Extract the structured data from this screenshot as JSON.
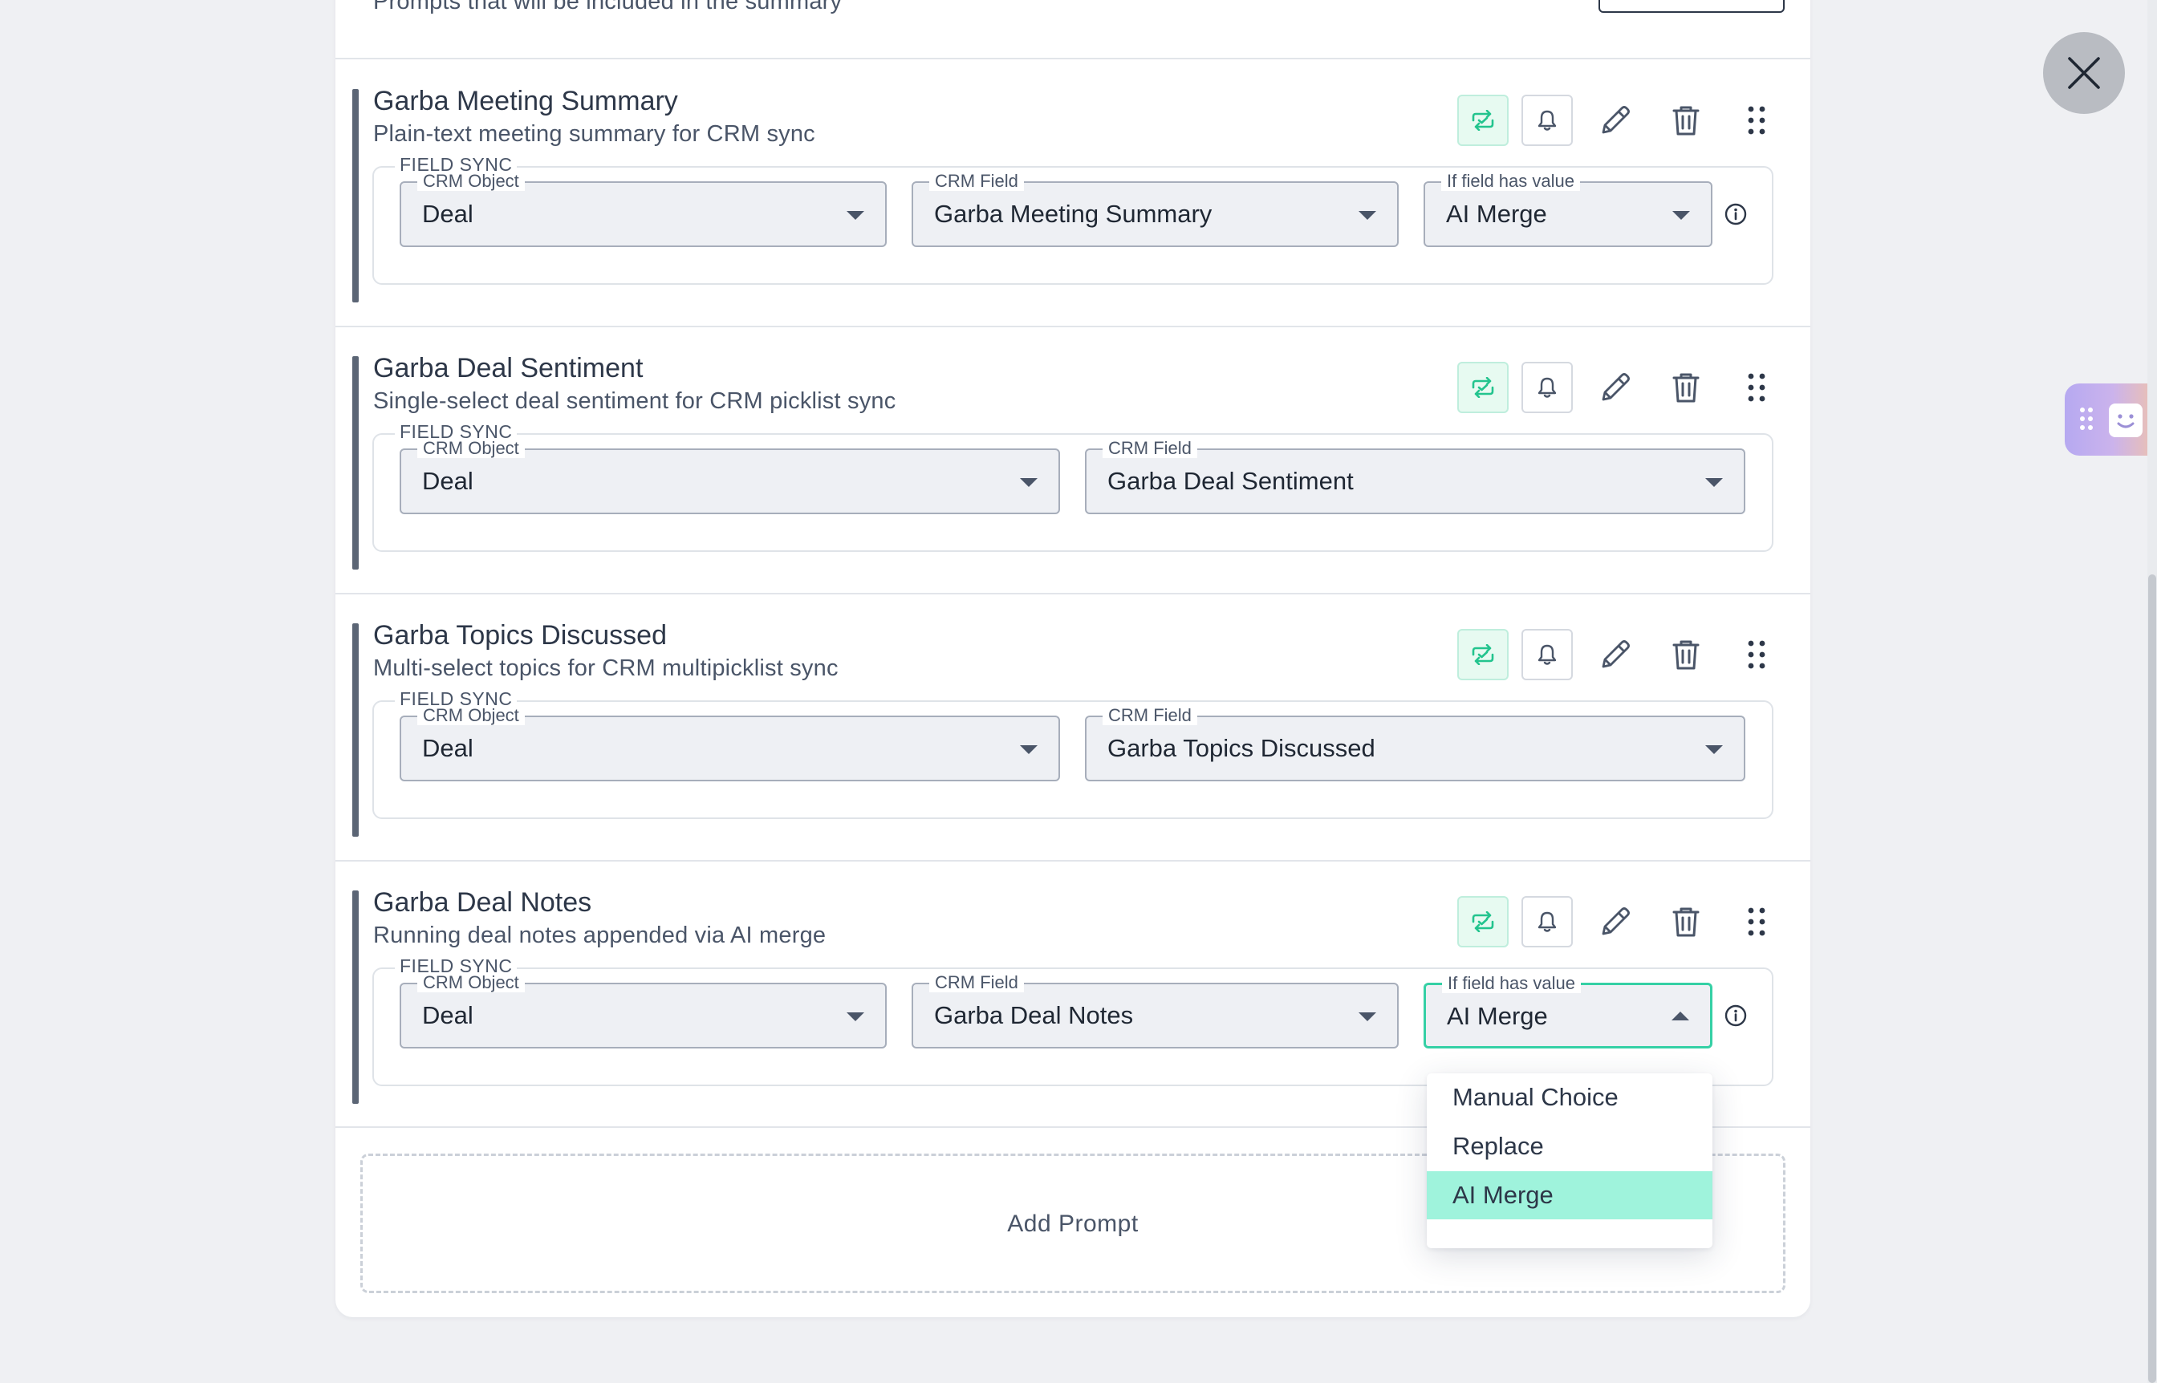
{
  "header": {
    "subtitle": "Prompts that will be included in the summary"
  },
  "prompts": [
    {
      "title": "Garba Meeting Summary",
      "description": "Plain-text meeting summary for CRM sync",
      "field_sync_label": "FIELD SYNC",
      "crm_object_label": "CRM Object",
      "crm_object": "Deal",
      "crm_field_label": "CRM Field",
      "crm_field": "Garba Meeting Summary",
      "if_value_label": "If field has value",
      "if_value": "AI Merge"
    },
    {
      "title": "Garba Deal Sentiment",
      "description": "Single-select deal sentiment for CRM picklist sync",
      "field_sync_label": "FIELD SYNC",
      "crm_object_label": "CRM Object",
      "crm_object": "Deal",
      "crm_field_label": "CRM Field",
      "crm_field": "Garba Deal Sentiment"
    },
    {
      "title": "Garba Topics Discussed",
      "description": "Multi-select topics for CRM multipicklist sync",
      "field_sync_label": "FIELD SYNC",
      "crm_object_label": "CRM Object",
      "crm_object": "Deal",
      "crm_field_label": "CRM Field",
      "crm_field": "Garba Topics Discussed"
    },
    {
      "title": "Garba Deal Notes",
      "description": "Running deal notes appended via AI merge",
      "field_sync_label": "FIELD SYNC",
      "crm_object_label": "CRM Object",
      "crm_object": "Deal",
      "crm_field_label": "CRM Field",
      "crm_field": "Garba Deal Notes",
      "if_value_label": "If field has value",
      "if_value": "AI Merge"
    }
  ],
  "dropdown": {
    "options": [
      "Manual Choice",
      "Replace",
      "AI Merge"
    ],
    "selected": "AI Merge"
  },
  "add_prompt_label": "Add Prompt",
  "icons": {
    "sync": "sync-check-icon",
    "bell": "bell-icon",
    "edit": "pencil-icon",
    "delete": "trash-icon",
    "drag": "drag-handle-icon",
    "info": "info-icon",
    "close": "close-icon",
    "widget": "smiley-icon"
  },
  "colors": {
    "accent_green": "#35d0a5",
    "selected_option_bg": "#9ff3dc",
    "sync_icon": "#23c48e",
    "card_accent_bar": "#5b6575"
  }
}
